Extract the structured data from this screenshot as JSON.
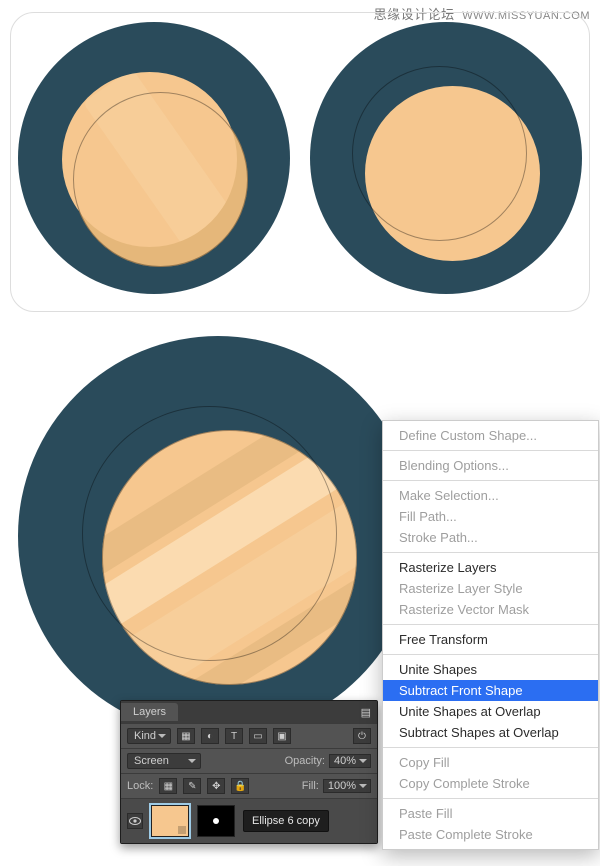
{
  "watermark": {
    "cn": "思缘设计论坛",
    "url": "WWW.MISSYUAN.COM"
  },
  "layers_panel": {
    "title": "Layers",
    "kind_label": "Kind",
    "mode_value": "Screen",
    "opacity_label": "Opacity:",
    "opacity_value": "40%",
    "lock_label": "Lock:",
    "fill_label": "Fill:",
    "fill_value": "100%",
    "layer_name": "Ellipse 6 copy"
  },
  "context_menu": {
    "items": [
      {
        "label": "Define Custom Shape...",
        "enabled": false
      },
      {
        "separator": true
      },
      {
        "label": "Blending Options...",
        "enabled": false
      },
      {
        "separator": true
      },
      {
        "label": "Make Selection...",
        "enabled": false
      },
      {
        "label": "Fill Path...",
        "enabled": false
      },
      {
        "label": "Stroke Path...",
        "enabled": false
      },
      {
        "separator": true
      },
      {
        "label": "Rasterize Layers",
        "enabled": true
      },
      {
        "label": "Rasterize Layer Style",
        "enabled": false
      },
      {
        "label": "Rasterize Vector Mask",
        "enabled": false
      },
      {
        "separator": true
      },
      {
        "label": "Free Transform",
        "enabled": true
      },
      {
        "separator": true
      },
      {
        "label": "Unite Shapes",
        "enabled": true
      },
      {
        "label": "Subtract Front Shape",
        "enabled": true,
        "highlight": true
      },
      {
        "label": "Unite Shapes at Overlap",
        "enabled": true
      },
      {
        "label": "Subtract Shapes at Overlap",
        "enabled": true
      },
      {
        "separator": true
      },
      {
        "label": "Copy Fill",
        "enabled": false
      },
      {
        "label": "Copy Complete Stroke",
        "enabled": false
      },
      {
        "separator": true
      },
      {
        "label": "Paste Fill",
        "enabled": false
      },
      {
        "label": "Paste Complete Stroke",
        "enabled": false
      }
    ]
  }
}
